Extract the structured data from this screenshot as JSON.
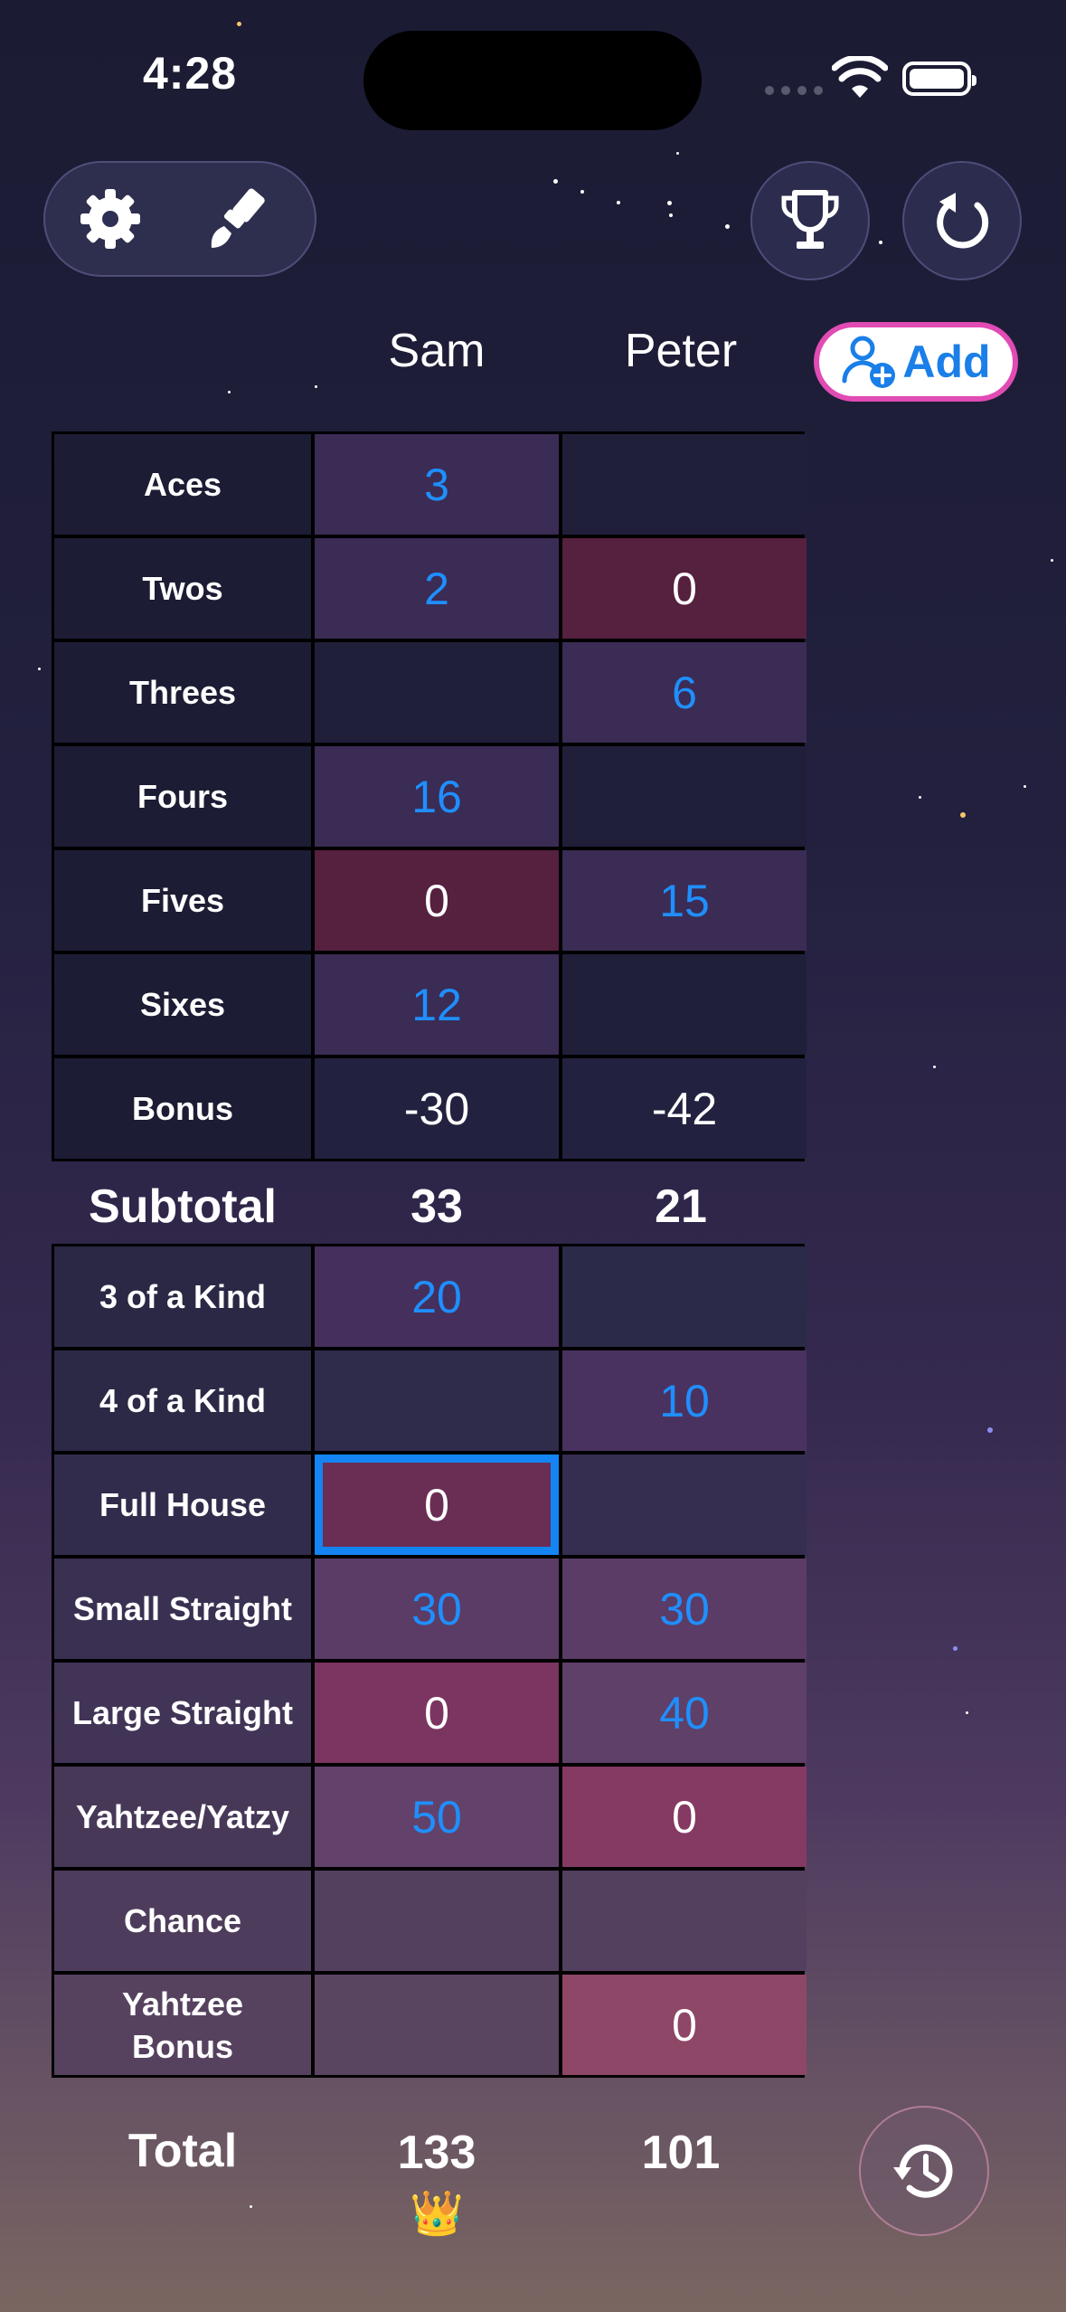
{
  "status": {
    "time": "4:28"
  },
  "players": [
    "Sam",
    "Peter"
  ],
  "add_button": {
    "label": "Add"
  },
  "upper": [
    {
      "label": "Aces",
      "sam": "3",
      "peter": ""
    },
    {
      "label": "Twos",
      "sam": "2",
      "peter": "0"
    },
    {
      "label": "Threes",
      "sam": "",
      "peter": "6"
    },
    {
      "label": "Fours",
      "sam": "16",
      "peter": ""
    },
    {
      "label": "Fives",
      "sam": "0",
      "peter": "15"
    },
    {
      "label": "Sixes",
      "sam": "12",
      "peter": ""
    },
    {
      "label": "Bonus",
      "sam": "-30",
      "peter": "-42"
    }
  ],
  "subtotal": {
    "label": "Subtotal",
    "sam": "33",
    "peter": "21"
  },
  "lower": [
    {
      "label": "3 of a Kind",
      "sam": "20",
      "peter": ""
    },
    {
      "label": "4 of a Kind",
      "sam": "",
      "peter": "10"
    },
    {
      "label": "Full House",
      "sam": "0",
      "peter": ""
    },
    {
      "label": "Small Straight",
      "sam": "30",
      "peter": "30"
    },
    {
      "label": "Large Straight",
      "sam": "0",
      "peter": "40"
    },
    {
      "label": "Yahtzee/Yatzy",
      "sam": "50",
      "peter": "0"
    },
    {
      "label": "Chance",
      "sam": "",
      "peter": ""
    },
    {
      "label": "Yahtzee Bonus",
      "sam": "",
      "peter": "0"
    }
  ],
  "total": {
    "label": "Total",
    "sam": "133",
    "peter": "101",
    "winner_badge": "👑"
  },
  "colors": {
    "accent": "#1f8fff",
    "selection": "#1484f2",
    "add_border": "#e14bb4"
  }
}
